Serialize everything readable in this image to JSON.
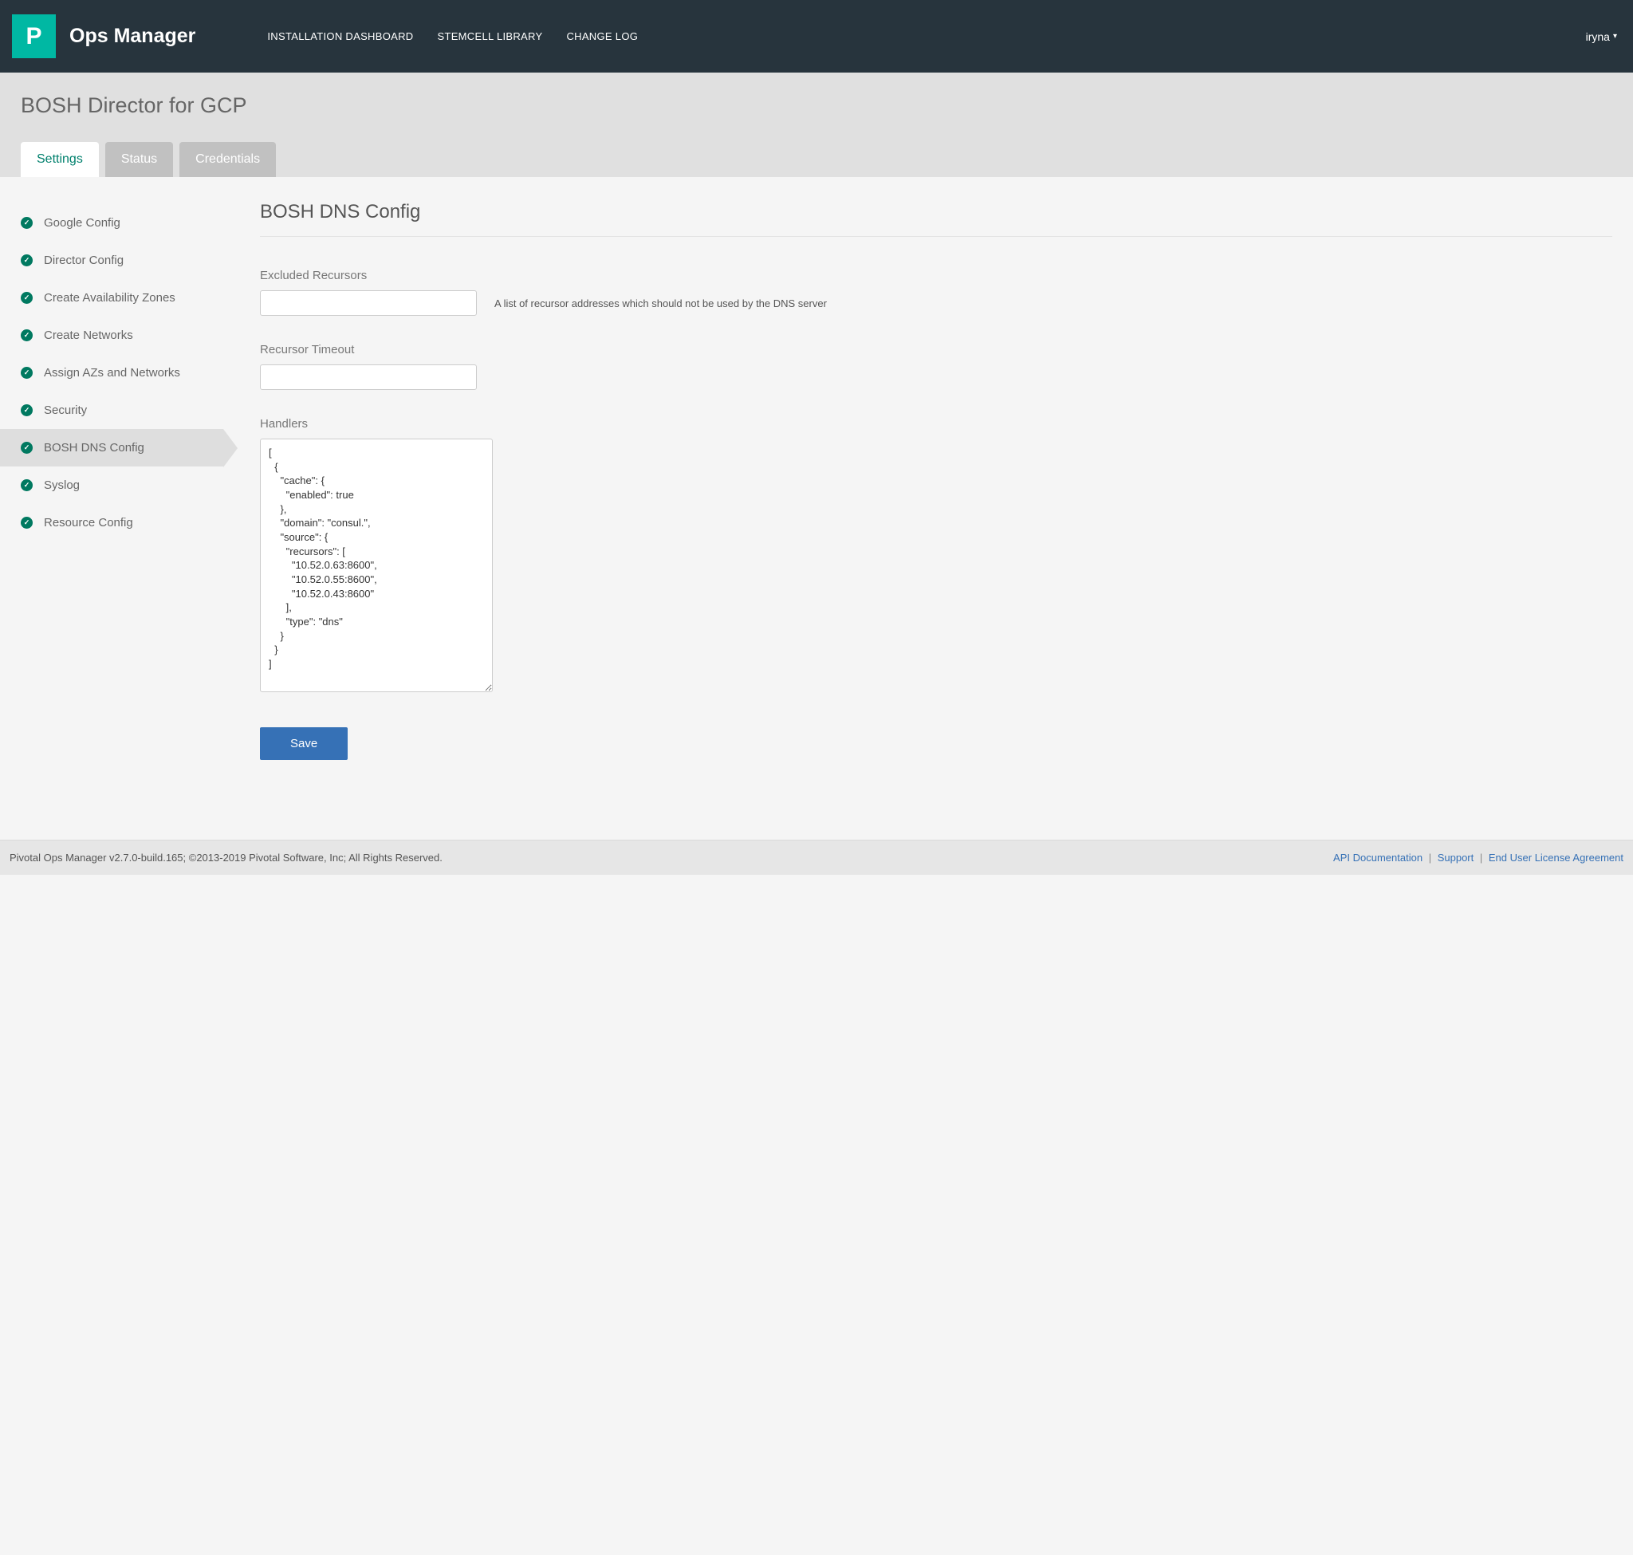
{
  "header": {
    "logo_letter": "P",
    "brand": "Ops Manager",
    "nav": [
      "INSTALLATION DASHBOARD",
      "STEMCELL LIBRARY",
      "CHANGE LOG"
    ],
    "user": "iryna"
  },
  "page": {
    "title": "BOSH Director for GCP",
    "tabs": [
      "Settings",
      "Status",
      "Credentials"
    ],
    "active_tab": 0
  },
  "sidebar": {
    "items": [
      "Google Config",
      "Director Config",
      "Create Availability Zones",
      "Create Networks",
      "Assign AZs and Networks",
      "Security",
      "BOSH DNS Config",
      "Syslog",
      "Resource Config"
    ],
    "active_index": 6
  },
  "section": {
    "title": "BOSH DNS Config",
    "fields": {
      "excluded_recursors": {
        "label": "Excluded Recursors",
        "value": "",
        "help": "A list of recursor addresses which should not be used by the DNS server"
      },
      "recursor_timeout": {
        "label": "Recursor Timeout",
        "value": ""
      },
      "handlers": {
        "label": "Handlers",
        "value": "[\n  {\n    \"cache\": {\n      \"enabled\": true\n    },\n    \"domain\": \"consul.\",\n    \"source\": {\n      \"recursors\": [\n        \"10.52.0.63:8600\",\n        \"10.52.0.55:8600\",\n        \"10.52.0.43:8600\"\n      ],\n      \"type\": \"dns\"\n    }\n  }\n]"
      }
    },
    "save_label": "Save"
  },
  "footer": {
    "copyright": "Pivotal Ops Manager v2.7.0-build.165; ©2013-2019 Pivotal Software, Inc; All Rights Reserved.",
    "links": [
      "API Documentation",
      "Support",
      "End User License Agreement"
    ]
  }
}
